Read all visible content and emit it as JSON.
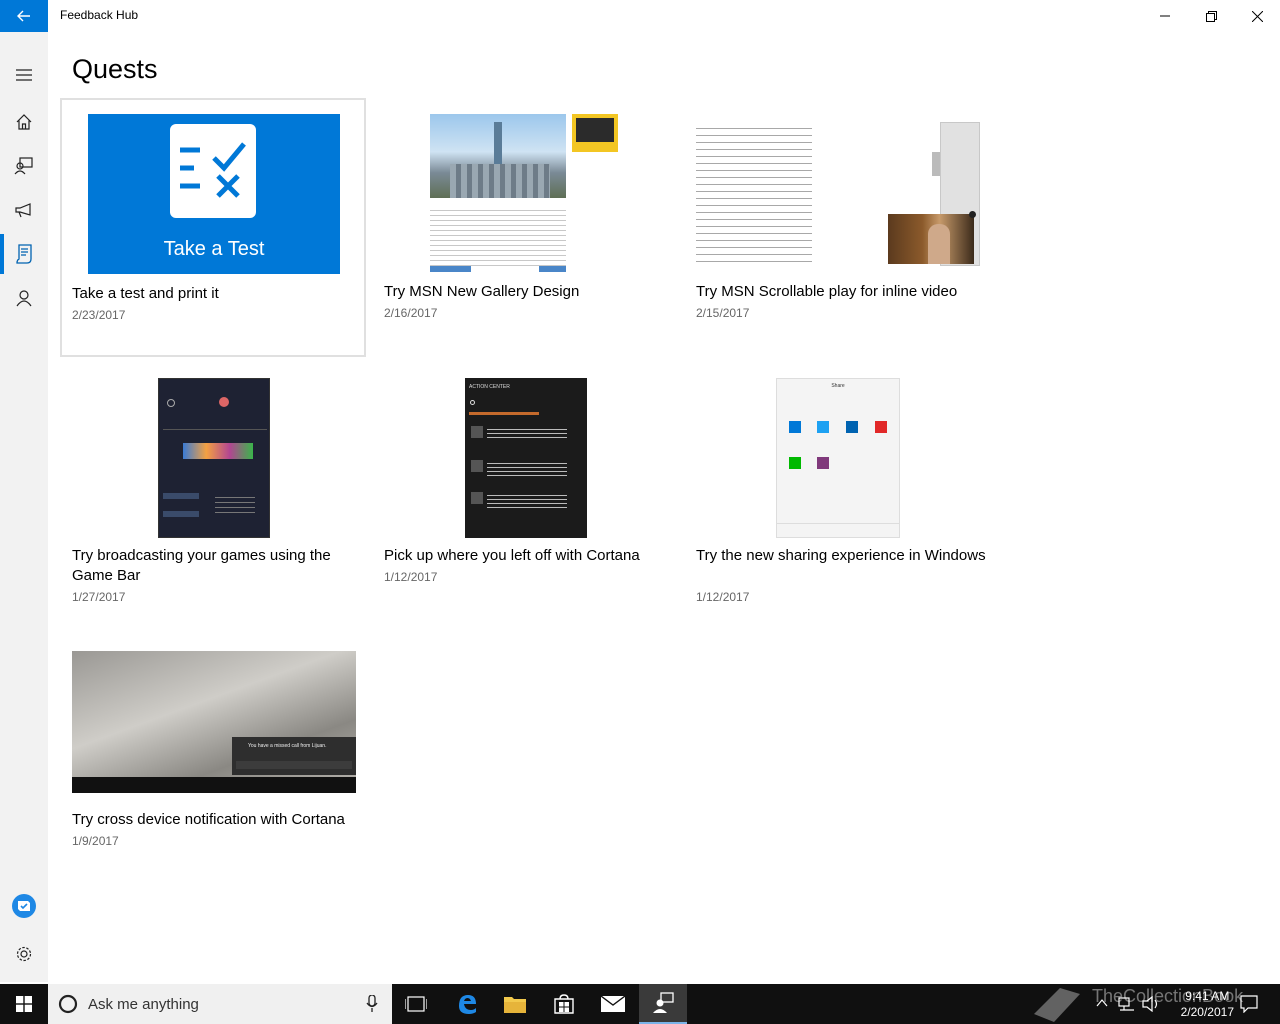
{
  "window": {
    "title": "Feedback Hub"
  },
  "page": {
    "title": "Quests"
  },
  "quests": [
    {
      "title": "Take a test and print it",
      "date": "2/23/2017",
      "thumb_text": "Take a Test"
    },
    {
      "title": "Try MSN New Gallery Design",
      "date": "2/16/2017"
    },
    {
      "title": "Try MSN Scrollable play for inline video",
      "date": "2/15/2017"
    },
    {
      "title": "Try broadcasting your games using the Game Bar",
      "date": "1/27/2017"
    },
    {
      "title": "Pick up where you left off with Cortana",
      "date": "1/12/2017",
      "thumb_text": "ACTION CENTER"
    },
    {
      "title": "Try the new sharing experience in Windows",
      "date": "1/12/2017",
      "thumb_text": "Share"
    },
    {
      "title": "Try cross device notification with Cortana",
      "date": "1/9/2017",
      "thumb_text": "You have a missed call from Lijuan."
    }
  ],
  "sidebar": {
    "items": [
      {
        "icon": "hamburger-menu-icon"
      },
      {
        "icon": "home-icon"
      },
      {
        "icon": "feedback-icon"
      },
      {
        "icon": "announcements-icon"
      },
      {
        "icon": "quests-icon",
        "active": true
      },
      {
        "icon": "profile-icon"
      }
    ],
    "bottom": [
      {
        "icon": "insider-icon"
      },
      {
        "icon": "settings-icon"
      }
    ]
  },
  "taskbar": {
    "search_placeholder": "Ask me anything",
    "time": "9:41 AM",
    "date": "2/20/2017",
    "watermark": "TheCollectionBook"
  },
  "colors": {
    "accent": "#0078d7",
    "sidebar_bg": "#f2f2f2",
    "taskbar_bg": "#101010"
  }
}
